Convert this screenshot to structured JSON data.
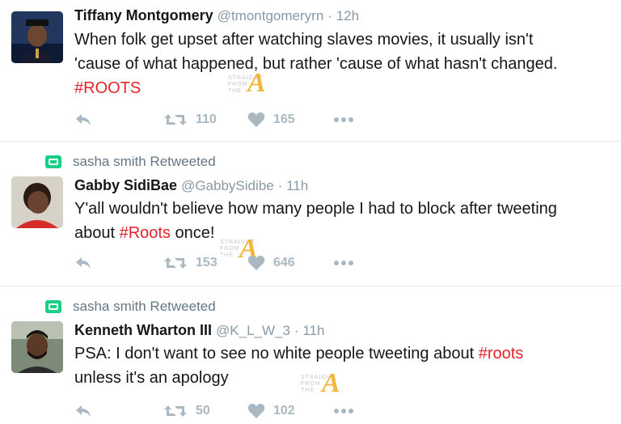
{
  "tweets": [
    {
      "retweeted_by": "",
      "name": "Tiffany Montgomery",
      "handle": "@tmontgomeryrn",
      "time": "12h",
      "text_lines": [
        {
          "plain": "When folk get upset after watching slaves movies, it usually isn't",
          "tag": ""
        },
        {
          "plain": "'cause of what happened, but rather 'cause of what hasn't changed.",
          "tag": ""
        },
        {
          "plain": "",
          "tag": "#ROOTS"
        }
      ],
      "retweets": "110",
      "likes": "165"
    },
    {
      "retweeted_by": "sasha smith Retweeted",
      "name": "Gabby SidiBae",
      "handle": "@GabbySidibe",
      "time": "11h",
      "text_lines": [
        {
          "plain": "Y'all wouldn't believe how many people I had to block after tweeting",
          "tag": ""
        },
        {
          "plain": "about ",
          "tag": "#Roots",
          "after": " once!"
        }
      ],
      "retweets": "153",
      "likes": "646"
    },
    {
      "retweeted_by": "sasha smith Retweeted",
      "name": "Kenneth Wharton III",
      "handle": "@K_L_W_3",
      "time": "11h",
      "text_lines": [
        {
          "plain": "PSA: I don't want to see no white people tweeting about ",
          "tag": "#roots"
        },
        {
          "plain": "unless it's an apology",
          "tag": ""
        }
      ],
      "retweets": "50",
      "likes": "102"
    }
  ],
  "watermark": {
    "letter": "A",
    "small": [
      "STRAIGHT",
      "FROM",
      "THE"
    ]
  },
  "colors": {
    "hashtag": "#e8222a",
    "muted": "#8899a6",
    "retweet_green": "#19cf86",
    "action_gray": "#aab8c2"
  },
  "icons": [
    "reply-icon",
    "retweet-icon",
    "heart-icon",
    "more-icon"
  ]
}
